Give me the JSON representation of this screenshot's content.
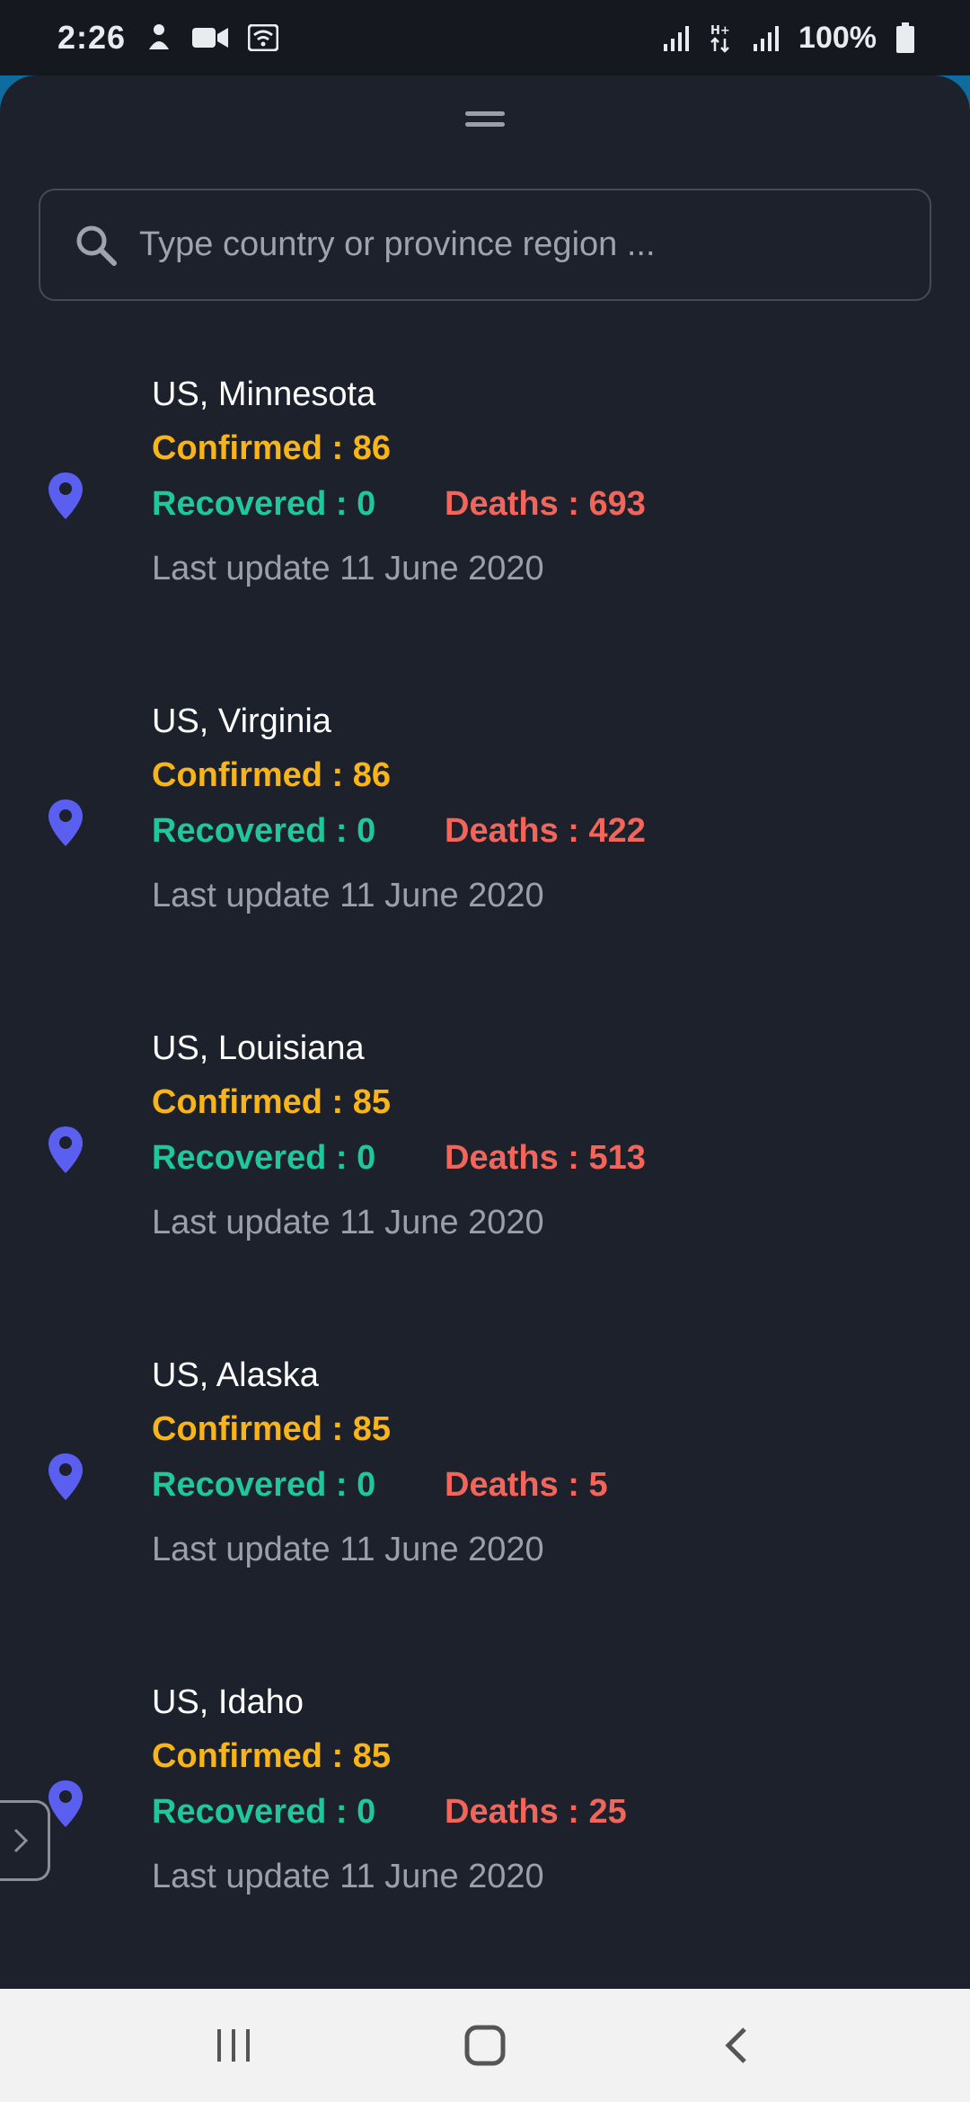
{
  "status_bar": {
    "time": "2:26",
    "battery": "100%"
  },
  "search": {
    "placeholder": "Type country or province region ..."
  },
  "colors": {
    "confirmed": "#f9b518",
    "recovered": "#1ec89a",
    "deaths": "#f2655a",
    "pin": "#5a5ff0"
  },
  "regions": [
    {
      "name": "US, Minnesota",
      "confirmed": "Confirmed : 86",
      "recovered": "Recovered : 0",
      "deaths": "Deaths : 693",
      "updated": "Last update 11 June 2020"
    },
    {
      "name": "US, Virginia",
      "confirmed": "Confirmed : 86",
      "recovered": "Recovered : 0",
      "deaths": "Deaths : 422",
      "updated": "Last update 11 June 2020"
    },
    {
      "name": "US, Louisiana",
      "confirmed": "Confirmed : 85",
      "recovered": "Recovered : 0",
      "deaths": "Deaths : 513",
      "updated": "Last update 11 June 2020"
    },
    {
      "name": "US, Alaska",
      "confirmed": "Confirmed : 85",
      "recovered": "Recovered : 0",
      "deaths": "Deaths : 5",
      "updated": "Last update 11 June 2020"
    },
    {
      "name": "US, Idaho",
      "confirmed": "Confirmed : 85",
      "recovered": "Recovered : 0",
      "deaths": "Deaths : 25",
      "updated": "Last update 11 June 2020"
    }
  ],
  "icons": {
    "search": "search-icon",
    "pin": "location-pin-icon",
    "handle": "drag-handle-icon",
    "side_tab": "chevron-right-icon",
    "nav_recents": "recents-icon",
    "nav_home": "home-icon",
    "nav_back": "back-icon"
  }
}
